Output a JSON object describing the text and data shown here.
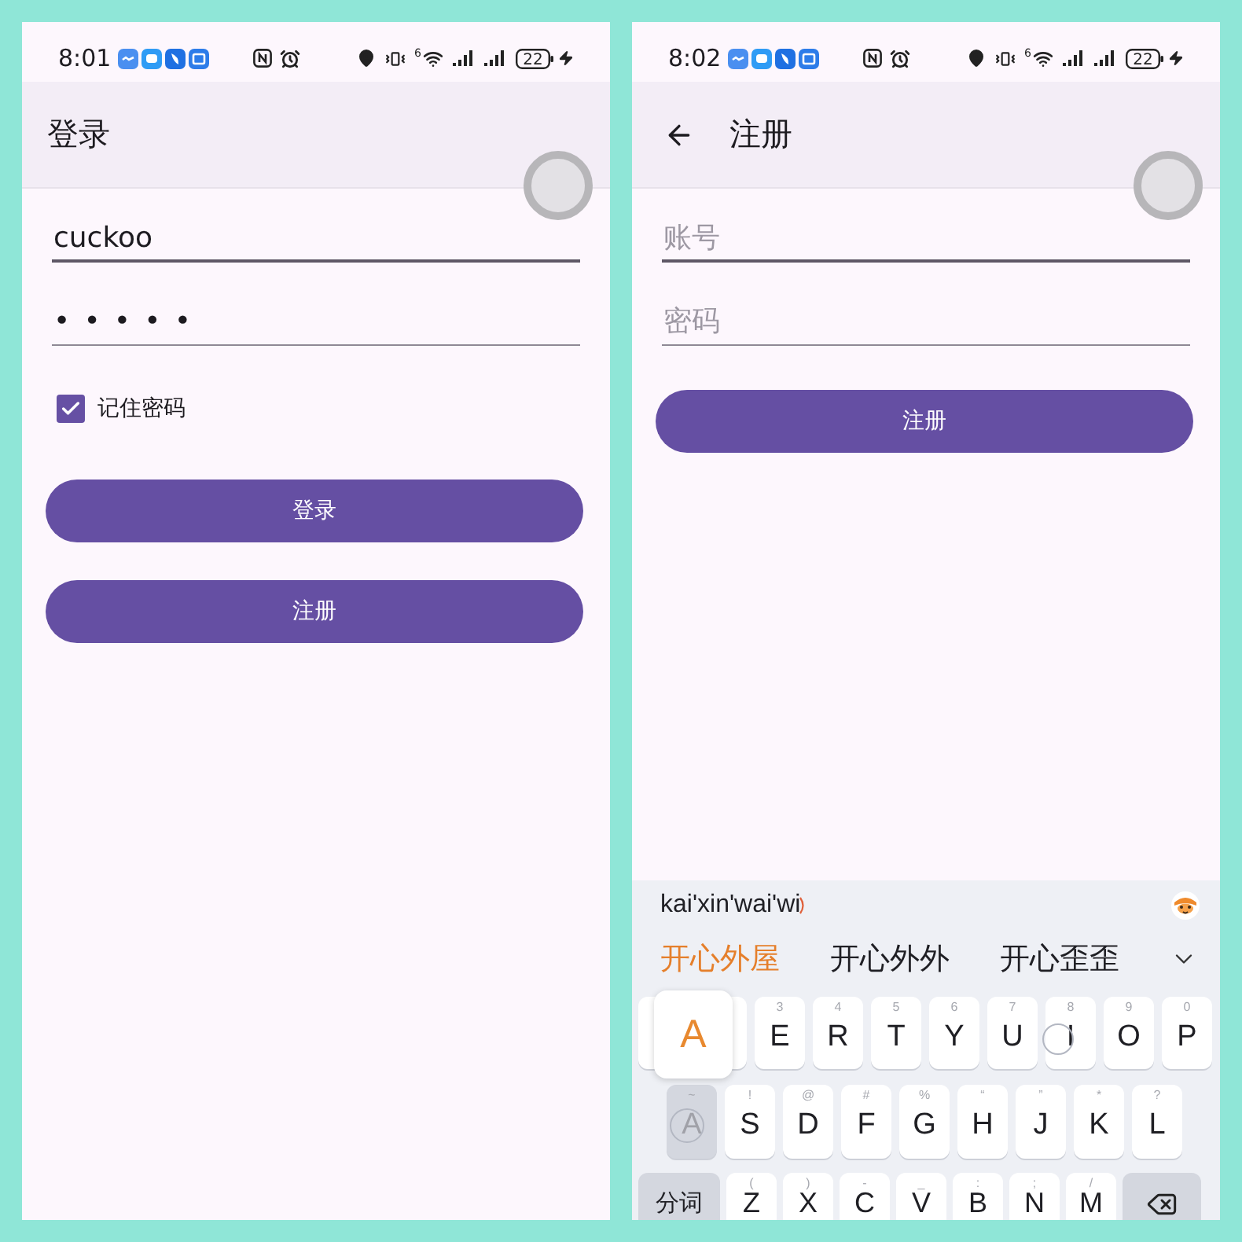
{
  "screens": [
    {
      "status_bar": {
        "time": "8:01",
        "wifi_standard": "6",
        "battery": "22"
      },
      "app_bar": {
        "title": "登录"
      },
      "fields": [
        {
          "value": "cuckoo",
          "focused": true
        },
        {
          "value": "•••••",
          "focused": false
        }
      ],
      "remember": {
        "label": "记住密码",
        "checked": true
      },
      "buttons": [
        "登录",
        "注册"
      ]
    },
    {
      "status_bar": {
        "time": "8:02",
        "wifi_standard": "6",
        "battery": "22"
      },
      "app_bar": {
        "title": "注册",
        "back": true
      },
      "fields": [
        {
          "placeholder": "账号",
          "focused": true
        },
        {
          "placeholder": "密码",
          "focused": false
        }
      ],
      "buttons": [
        "注册"
      ],
      "keyboard": {
        "composition": "kai'xin'wai'wi",
        "candidates": [
          {
            "text": "开心外屋",
            "selected": true
          },
          {
            "text": "开心外外",
            "selected": false
          },
          {
            "text": "开心歪歪",
            "selected": false
          }
        ],
        "popup": "A",
        "rows": [
          [
            {
              "kind": "covered",
              "pressed": false
            },
            {
              "kind": "covered",
              "pressed": false
            },
            {
              "kind": "letter",
              "label": "E",
              "hint": "3",
              "pressed": false
            },
            {
              "kind": "letter",
              "label": "R",
              "hint": "4",
              "pressed": false
            },
            {
              "kind": "letter",
              "label": "T",
              "hint": "5",
              "pressed": false
            },
            {
              "kind": "letter",
              "label": "Y",
              "hint": "6",
              "pressed": false
            },
            {
              "kind": "letter",
              "label": "U",
              "hint": "7",
              "pressed": false
            },
            {
              "kind": "letter",
              "label": "I",
              "hint": "8",
              "pressed": false
            },
            {
              "kind": "letter",
              "label": "O",
              "hint": "9",
              "pressed": false
            },
            {
              "kind": "letter",
              "label": "P",
              "hint": "0",
              "pressed": false
            }
          ],
          [
            {
              "kind": "letter",
              "label": "A",
              "hint": "~",
              "pressed": true
            },
            {
              "kind": "letter",
              "label": "S",
              "hint": "!",
              "pressed": false
            },
            {
              "kind": "letter",
              "label": "D",
              "hint": "@",
              "pressed": false
            },
            {
              "kind": "letter",
              "label": "F",
              "hint": "#",
              "pressed": false
            },
            {
              "kind": "letter",
              "label": "G",
              "hint": "%",
              "pressed": false
            },
            {
              "kind": "letter",
              "label": "H",
              "hint": "“",
              "pressed": false
            },
            {
              "kind": "letter",
              "label": "J",
              "hint": "”",
              "pressed": false
            },
            {
              "kind": "letter",
              "label": "K",
              "hint": "*",
              "pressed": false
            },
            {
              "kind": "letter",
              "label": "L",
              "hint": "?",
              "pressed": false
            }
          ],
          [
            {
              "kind": "function",
              "label": "分词",
              "pressed": false
            },
            {
              "kind": "letter",
              "label": "Z",
              "hint": "(",
              "pressed": false
            },
            {
              "kind": "letter",
              "label": "X",
              "hint": ")",
              "pressed": false
            },
            {
              "kind": "letter",
              "label": "C",
              "hint": "-",
              "pressed": false
            },
            {
              "kind": "letter",
              "label": "V",
              "hint": "_",
              "pressed": false
            },
            {
              "kind": "letter",
              "label": "B",
              "hint": ":",
              "pressed": false
            },
            {
              "kind": "letter",
              "label": "N",
              "hint": ";",
              "pressed": false
            },
            {
              "kind": "letter",
              "label": "M",
              "hint": "/",
              "pressed": false
            },
            {
              "kind": "delete",
              "pressed": false
            }
          ]
        ]
      }
    }
  ]
}
